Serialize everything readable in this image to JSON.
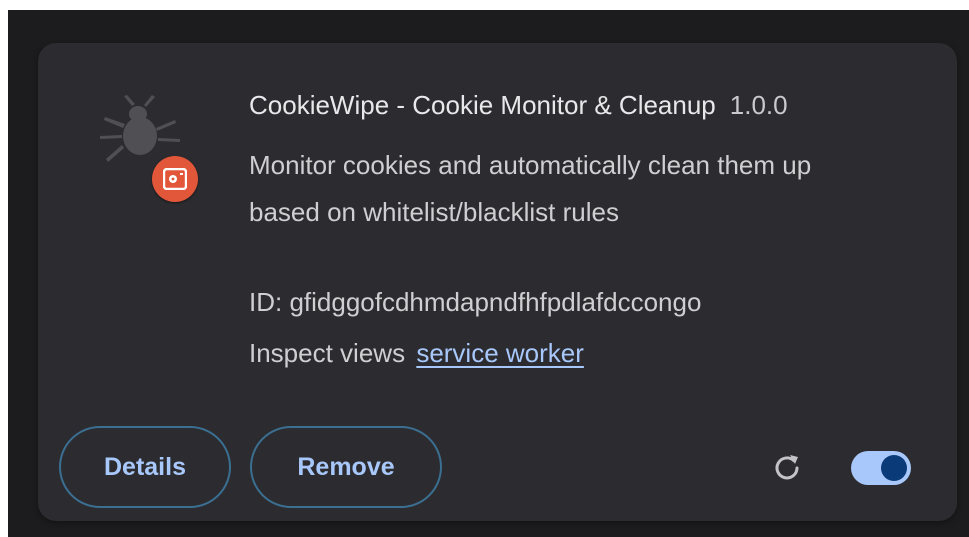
{
  "extension": {
    "name": "CookieWipe - Cookie Monitor & Cleanup",
    "version": "1.0.0",
    "description": "Monitor cookies and automatically clean them up based on whitelist/blacklist rules",
    "id_label": "ID: gfidggofcdhmdapndfhfpdlafdccongo",
    "inspect_label": "Inspect views",
    "inspect_link": "service worker",
    "enabled": true
  },
  "actions": {
    "details_label": "Details",
    "remove_label": "Remove"
  },
  "icons": {
    "extension_icon": "bug-icon",
    "badge": "badge-icon",
    "reload": "reload-icon",
    "toggle": "toggle-switch"
  },
  "colors": {
    "card_bg": "#2c2c30",
    "link": "#a8c7fa",
    "badge": "#e2563a",
    "toggle_track": "#a8c7fa",
    "toggle_knob": "#0b3a78"
  }
}
